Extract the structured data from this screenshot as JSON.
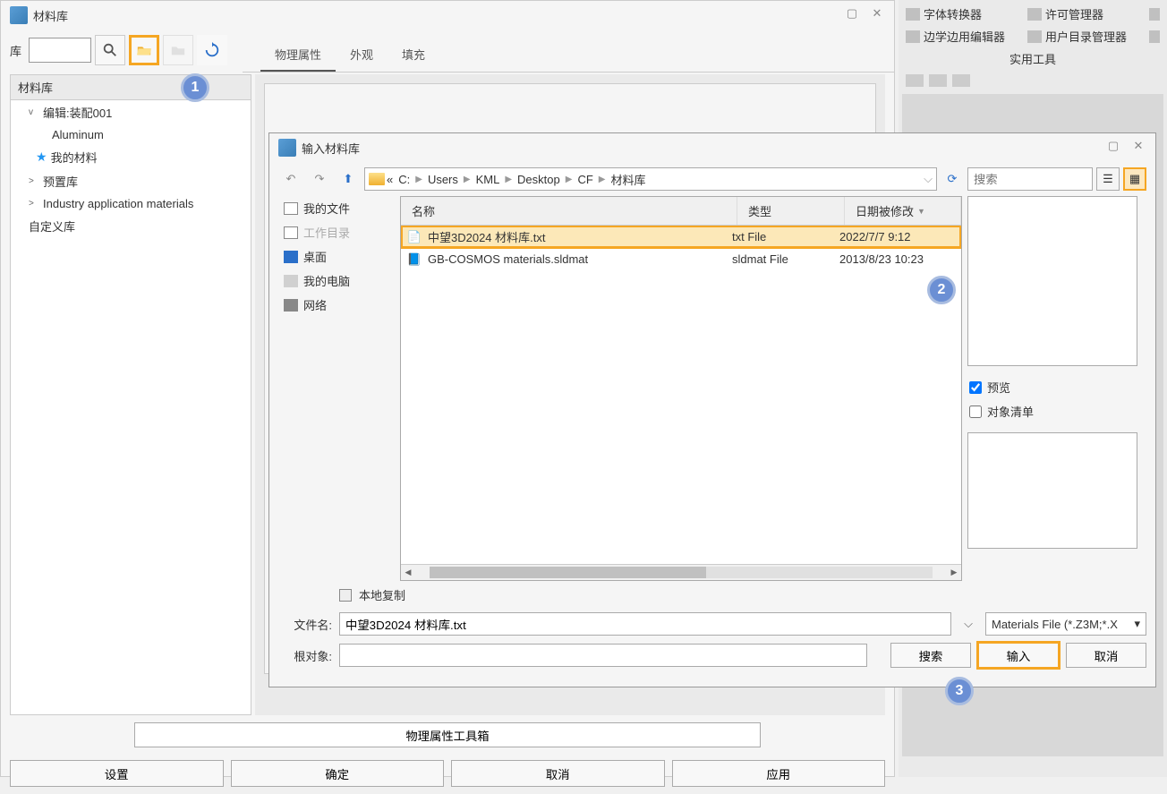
{
  "main_window": {
    "title": "材料库",
    "lib_label": "库",
    "tabs": [
      "物理属性",
      "外观",
      "填充"
    ],
    "tree_header": "材料库",
    "tree": [
      {
        "label": "编辑:装配001",
        "expand": "v",
        "lvl": 1
      },
      {
        "label": "Aluminum",
        "expand": "",
        "lvl": 3
      },
      {
        "label": "我的材料",
        "expand": "",
        "lvl": 2,
        "star": true
      },
      {
        "label": "预置库",
        "expand": ">",
        "lvl": 1
      },
      {
        "label": "Industry application materials",
        "expand": ">",
        "lvl": 1
      },
      {
        "label": "自定义库",
        "expand": "",
        "lvl": 1
      }
    ],
    "toolbox_btn": "物理属性工具箱",
    "bottom_buttons": [
      "设置",
      "确定",
      "取消",
      "应用"
    ]
  },
  "import_dialog": {
    "title": "输入材料库",
    "breadcrumb": [
      "C:",
      "Users",
      "KML",
      "Desktop",
      "CF",
      "材料库"
    ],
    "search_placeholder": "搜索",
    "places": [
      {
        "label": "我的文件",
        "icon": "pi-doc"
      },
      {
        "label": "工作目录",
        "icon": "pi-doc",
        "disabled": true
      },
      {
        "label": "桌面",
        "icon": "pi-desk"
      },
      {
        "label": "我的电脑",
        "icon": "pi-comp"
      },
      {
        "label": "网络",
        "icon": "pi-net"
      }
    ],
    "columns": {
      "name": "名称",
      "type": "类型",
      "date": "日期被修改"
    },
    "files": [
      {
        "name": "中望3D2024 材料库.txt",
        "type": "txt File",
        "date": "2022/7/7 9:12",
        "sel": true
      },
      {
        "name": "GB-COSMOS materials.sldmat",
        "type": "sldmat File",
        "date": "2013/8/23 10:23",
        "sel": false
      }
    ],
    "preview_label": "预览",
    "object_list_label": "对象清单",
    "local_copy_label": "本地复制",
    "filename_label": "文件名:",
    "filename_value": "中望3D2024 材料库.txt",
    "root_label": "根对象:",
    "type_filter": "Materials File (*.Z3M;*.X",
    "search_btn": "搜索",
    "import_btn": "输入",
    "cancel_btn": "取消"
  },
  "right_tools": {
    "items": [
      {
        "label": "字体转换器"
      },
      {
        "label": "许可管理器"
      },
      {
        "label": "边学边用编辑器"
      },
      {
        "label": "用户目录管理器"
      }
    ],
    "section_label": "实用工具"
  },
  "callouts": {
    "1": "1",
    "2": "2",
    "3": "3"
  }
}
